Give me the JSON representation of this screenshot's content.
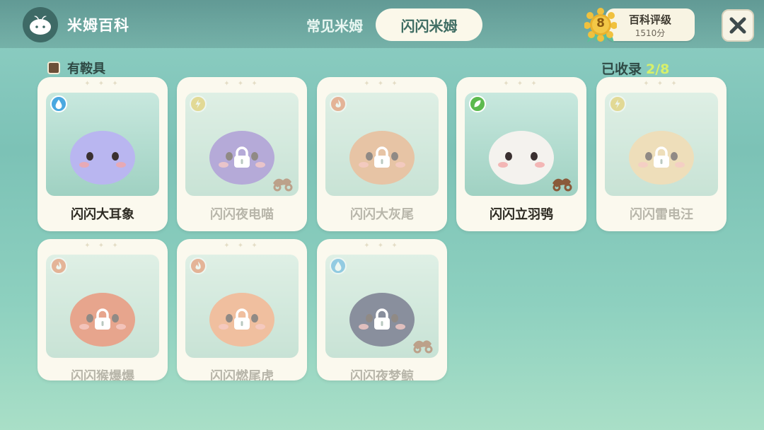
{
  "header": {
    "title": "米姆百科",
    "tabs": [
      "常见米姆",
      "闪闪米姆"
    ],
    "active_tab": "闪闪米姆",
    "rating": {
      "level": "8",
      "title": "百科评级",
      "score": "1510分"
    }
  },
  "filter": {
    "saddle_label": "有鞍具"
  },
  "collection": {
    "label": "已收录",
    "count": "2/8"
  },
  "cards": [
    {
      "name": "闪闪大耳象",
      "element": "water",
      "locked": false,
      "saddle": false
    },
    {
      "name": "闪闪夜电喵",
      "element": "electric",
      "locked": true,
      "saddle": true
    },
    {
      "name": "闪闪大灰尾",
      "element": "fire",
      "locked": true,
      "saddle": false
    },
    {
      "name": "闪闪立羽鸮",
      "element": "grass",
      "locked": false,
      "saddle": true
    },
    {
      "name": "闪闪雷电汪",
      "element": "electric",
      "locked": true,
      "saddle": false
    },
    {
      "name": "闪闪猴爆爆",
      "element": "fire",
      "locked": true,
      "saddle": false
    },
    {
      "name": "闪闪燃尾虎",
      "element": "fire",
      "locked": true,
      "saddle": false
    },
    {
      "name": "闪闪夜梦鲸",
      "element": "water",
      "locked": true,
      "saddle": true
    }
  ],
  "colors": {
    "accent": "#d7f06a",
    "tab_active_bg": "#fbf8ea",
    "water": "#4aa8e0",
    "electric": "#e8c64a",
    "fire": "#ec7a4d",
    "grass": "#5cba4e"
  }
}
